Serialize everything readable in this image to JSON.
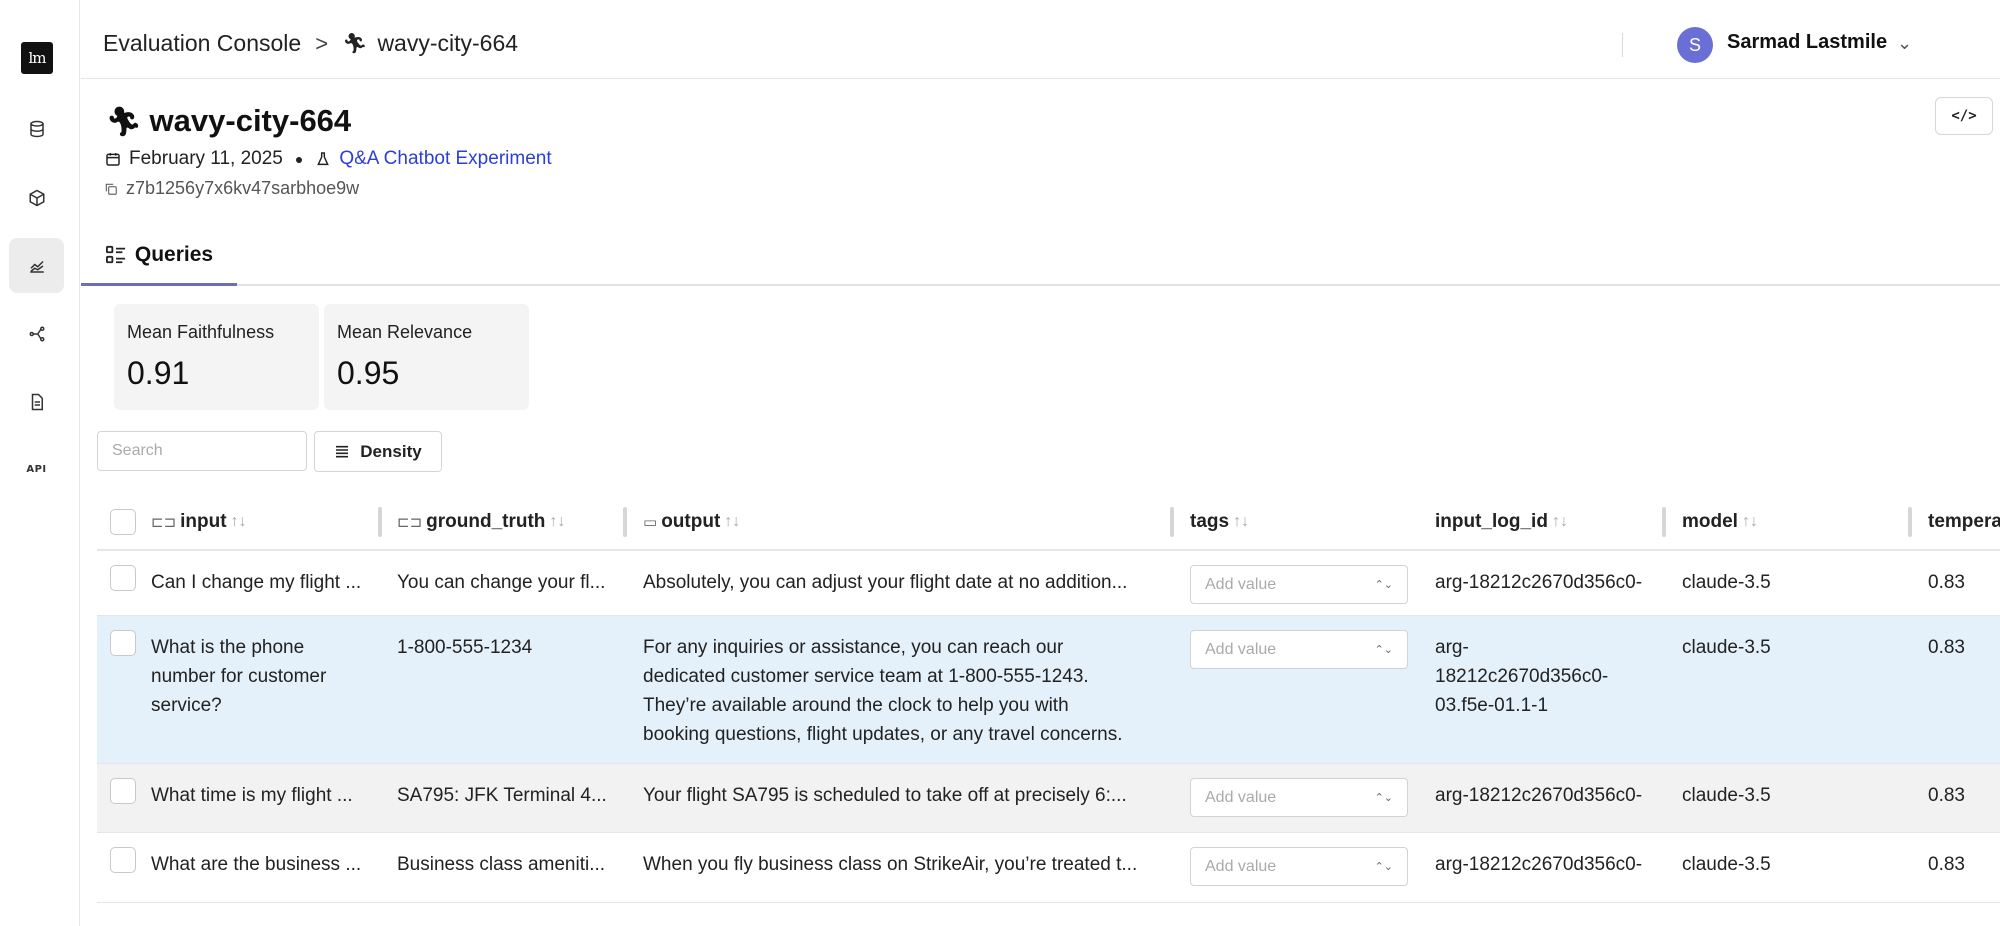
{
  "sidebar": {
    "logo": "lm",
    "items": [
      {
        "icon": "database-icon"
      },
      {
        "icon": "cube-icon"
      },
      {
        "icon": "chart-icon",
        "active": true
      },
      {
        "icon": "graph-icon"
      },
      {
        "icon": "document-icon"
      },
      {
        "icon": "api-icon",
        "label": "API"
      }
    ]
  },
  "header": {
    "breadcrumb_root": "Evaluation Console",
    "breadcrumb_sep": ">",
    "breadcrumb_current": "wavy-city-664",
    "user_initial": "S",
    "user_name": "Sarmad Lastmile"
  },
  "run": {
    "title": "wavy-city-664",
    "date": "February 11, 2025",
    "experiment": "Q&A Chatbot Experiment",
    "id": "z7b1256y7x6kv47sarbhoe9w",
    "code_button": "</>"
  },
  "tabs": [
    {
      "label": "Queries",
      "active": true
    }
  ],
  "metrics": [
    {
      "label": "Mean Faithfulness",
      "value": "0.91"
    },
    {
      "label": "Mean Relevance",
      "value": "0.95"
    }
  ],
  "toolbar": {
    "search_placeholder": "Search",
    "density_label": "Density"
  },
  "table": {
    "columns": [
      {
        "key": "input",
        "label": "input"
      },
      {
        "key": "ground_truth",
        "label": "ground_truth"
      },
      {
        "key": "output",
        "label": "output"
      },
      {
        "key": "tags",
        "label": "tags"
      },
      {
        "key": "input_log_id",
        "label": "input_log_id"
      },
      {
        "key": "model",
        "label": "model"
      },
      {
        "key": "temperature",
        "label": "tempera"
      }
    ],
    "sort_glyph": "↑↓",
    "tag_placeholder": "Add value",
    "rows": [
      {
        "input": "Can I change my flight ...",
        "ground_truth": "You can change your fl...",
        "output": "Absolutely, you can adjust your flight date at no addition...",
        "input_log_id": "arg-18212c2670d356c0-",
        "model": "claude-3.5",
        "temperature": "0.83"
      },
      {
        "input_lines": [
          "What is the phone",
          "number for customer",
          "service?"
        ],
        "ground_truth": "1-800-555-1234",
        "output_lines": [
          "For any inquiries or assistance, you can reach our",
          "dedicated customer service team at 1-800-555-1243.",
          "They’re available around the clock to help you with",
          "booking questions, flight updates, or any travel concerns."
        ],
        "input_log_id_lines": [
          "arg-",
          "18212c2670d356c0-",
          "03.f5e-01.1-1"
        ],
        "model": "claude-3.5",
        "temperature": "0.83"
      },
      {
        "input": "What time is my flight ...",
        "ground_truth": "SA795: JFK Terminal 4...",
        "output": "Your flight SA795 is scheduled to take off at precisely 6:...",
        "input_log_id": "arg-18212c2670d356c0-",
        "model": "claude-3.5",
        "temperature": "0.83"
      },
      {
        "input": "What are the business ...",
        "ground_truth": "Business class ameniti...",
        "output": "When you fly business class on StrikeAir, you’re treated t...",
        "input_log_id": "arg-18212c2670d356c0-",
        "model": "claude-3.5",
        "temperature": "0.83"
      }
    ]
  }
}
